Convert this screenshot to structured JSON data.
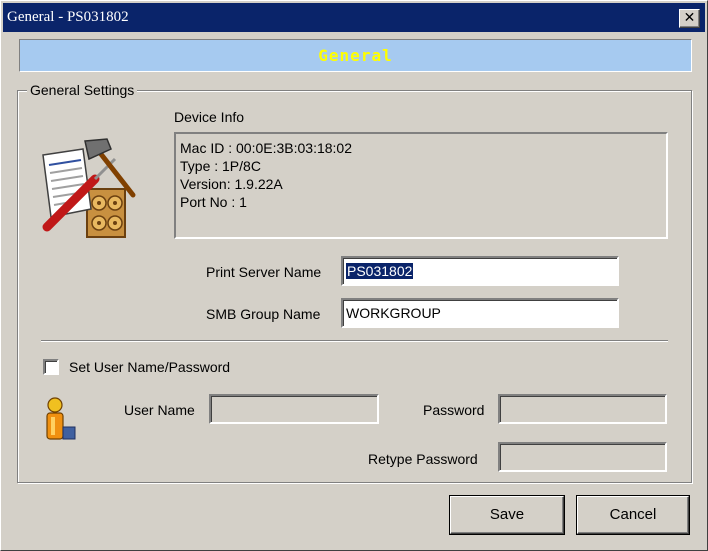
{
  "window": {
    "title": "General - PS031802",
    "close_label": "✕"
  },
  "banner": {
    "title": "General"
  },
  "group": {
    "legend": "General Settings",
    "device_info_label": "Device Info",
    "device_info": [
      "Mac ID : 00:0E:3B:03:18:02",
      "Type : 1P/8C",
      "Version: 1.9.22A",
      "Port No : 1"
    ],
    "print_server_name_label": "Print Server Name",
    "print_server_name_value": "PS031802",
    "smb_group_name_label": "SMB Group Name",
    "smb_group_name_value": "WORKGROUP"
  },
  "auth": {
    "checkbox_label": "Set User Name/Password",
    "checked": false,
    "user_name_label": "User Name",
    "user_name_value": "",
    "password_label": "Password",
    "password_value": "",
    "retype_password_label": "Retype Password",
    "retype_password_value": ""
  },
  "buttons": {
    "save_label": "Save",
    "cancel_label": "Cancel"
  },
  "icons": {
    "settings": "document-tools-icon",
    "user": "user-icon"
  },
  "colors": {
    "titlebar": "#0a246a",
    "banner_bg": "#a6caf0",
    "banner_text": "#ffff00",
    "dialog_bg": "#d4d0c8"
  }
}
